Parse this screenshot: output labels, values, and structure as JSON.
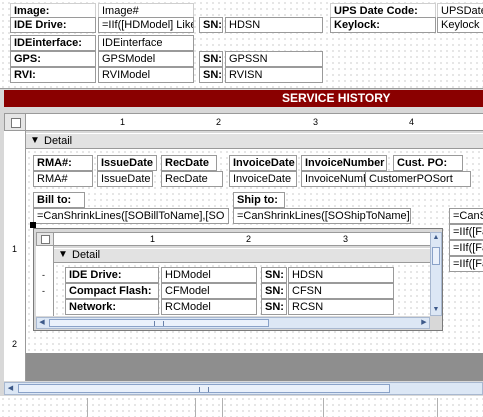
{
  "top_section": {
    "rows": [
      {
        "label": "Image:",
        "value": "Image#"
      },
      {
        "label": "IDE Drive:",
        "value": "=IIf([HDModel] Like '"
      },
      {
        "label": "IDEinterface:",
        "value": "IDEinterface"
      },
      {
        "label": "GPS:",
        "value": "GPSModel"
      },
      {
        "label": "RVI:",
        "value": "RVIModel"
      }
    ],
    "sn_rows": [
      {
        "label": "SN:",
        "value": "HDSN"
      },
      {
        "label": "SN:",
        "value": "GPSSN"
      },
      {
        "label": "SN:",
        "value": "RVISN"
      }
    ],
    "right_rows": [
      {
        "label": "UPS Date Code:",
        "value": "UPSDate"
      },
      {
        "label": "Keylock:",
        "value": "Keylock"
      }
    ]
  },
  "service_history_banner": "SERVICE HISTORY",
  "main_ruler": {
    "ticks": [
      "1",
      "2",
      "3",
      "4"
    ]
  },
  "detail_header": "Detail",
  "columns": [
    {
      "label": "RMA#:",
      "value": "RMA#"
    },
    {
      "label": "IssueDate",
      "value": "IssueDate"
    },
    {
      "label": "RecDate",
      "value": "RecDate"
    },
    {
      "label": "InvoiceDate",
      "value": "InvoiceDate"
    },
    {
      "label": "InvoiceNumber",
      "value": "InvoiceNumber"
    },
    {
      "label": "Cust. PO:",
      "value": "CustomerPOSort"
    }
  ],
  "bill_to": {
    "label": "Bill to:",
    "value": "=CanShrinkLines([SOBillToName],[SO"
  },
  "ship_to": {
    "label": "Ship to:",
    "value": "=CanShrinkLines([SOShipToName],["
  },
  "right_formulas": [
    "=CanS",
    "=IIf([Fa",
    "=IIf([Fa",
    "=IIf([Fa"
  ],
  "left_ruler_marks": [
    "1",
    "2"
  ],
  "subform": {
    "ruler": {
      "ticks": [
        "1",
        "2",
        "3"
      ]
    },
    "detail_header": "Detail",
    "rows": [
      {
        "label": "IDE Drive:",
        "value": "HDModel",
        "sn_label": "SN:",
        "sn_value": "HDSN"
      },
      {
        "label": "Compact Flash:",
        "value": "CFModel",
        "sn_label": "SN:",
        "sn_value": "CFSN"
      },
      {
        "label": "Network:",
        "value": "RCModel",
        "sn_label": "SN:",
        "sn_value": "RCSN"
      }
    ],
    "left_marks": [
      "-",
      "-"
    ]
  },
  "colors": {
    "banner": "#8a0000",
    "banner_text": "#ffffff",
    "selected_handle": "#000000"
  }
}
